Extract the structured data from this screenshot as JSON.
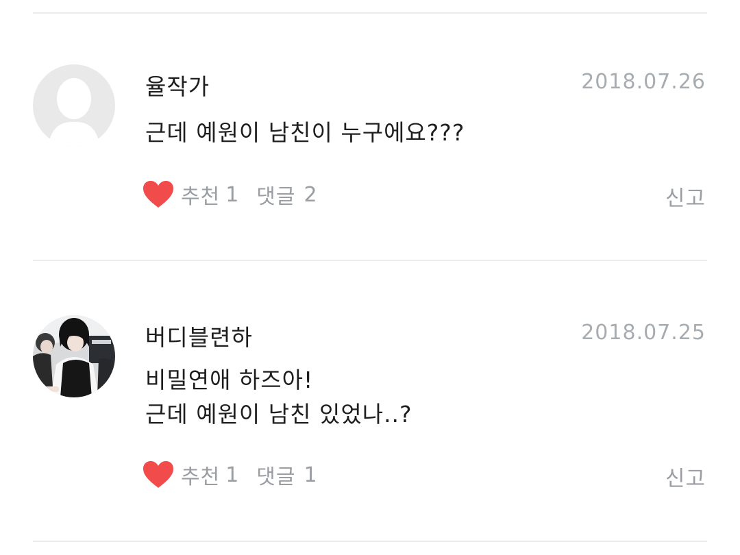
{
  "comments": [
    {
      "author": "율작가",
      "date": "2018.07.26",
      "lines": [
        "근데 예원이 남친이 누구에요???"
      ],
      "like_label": "추천",
      "like_count": "1",
      "reply_label": "댓글",
      "reply_count": "2",
      "report_label": "신고",
      "avatar": "default-user-icon"
    },
    {
      "author": "버디블련하",
      "date": "2018.07.25",
      "lines": [
        "비밀연애 하즈아!",
        "근데 예원이 남친 있었나..?"
      ],
      "like_label": "추천",
      "like_count": "1",
      "reply_label": "댓글",
      "reply_count": "1",
      "report_label": "신고",
      "avatar": "user-photo"
    }
  ],
  "colors": {
    "heart": "#f24b4b",
    "meta_text": "#9a9ea3",
    "date_text": "#a7acb1",
    "divider": "#ebebeb"
  }
}
